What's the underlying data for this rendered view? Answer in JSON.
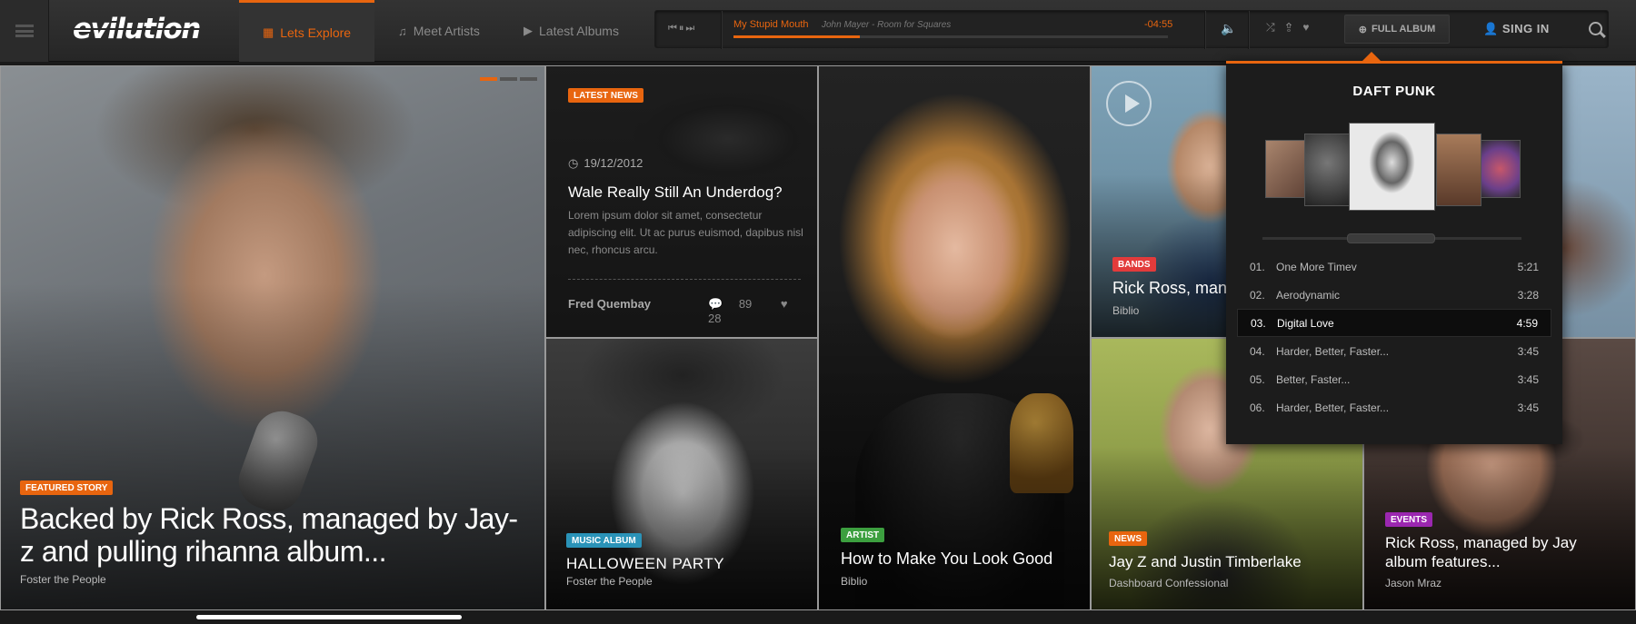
{
  "brand": {
    "logo": "evilution",
    "accent": "#e8650f"
  },
  "nav": {
    "items": [
      {
        "label": "Lets Explore",
        "icon": "grid-icon",
        "active": true
      },
      {
        "label": "Meet Artists",
        "icon": "music-note-icon"
      },
      {
        "label": "Latest Albums",
        "icon": "youtube-icon"
      }
    ],
    "signin": "SING IN"
  },
  "player": {
    "track": "My Stupid Mouth",
    "artist_album": "John Mayer - Room for Squares",
    "time": "-04:55",
    "progress": 0.29,
    "full_album_label": "FULL ALBUM"
  },
  "tiles": {
    "featured": {
      "badge": "FEATURED STORY",
      "title": "Backed by Rick Ross, managed by Jay-z and pulling rihanna album...",
      "sub": "Foster the People"
    },
    "latest_news": {
      "badge": "LATEST NEWS",
      "date": "19/12/2012",
      "title": "Wale Really Still An Underdog?",
      "text": "Lorem ipsum dolor sit amet, consectetur adipiscing elit. Ut ac purus euismod, dapibus nisl nec, rhoncus arcu.",
      "author": "Fred Quembay",
      "comments": "89",
      "likes": "28"
    },
    "music_album": {
      "badge": "MUSIC ALBUM",
      "title": "HALLOWEEN PARTY",
      "sub": "Foster the People"
    },
    "artist": {
      "badge": "ARTIST",
      "title": "How to Make You Look Good",
      "sub": "Biblio"
    },
    "bands": {
      "badge": "BANDS",
      "title": "Rick Ross, man",
      "sub": "Biblio"
    },
    "news": {
      "badge": "NEWS",
      "title": "Jay Z and Justin Timberlake",
      "sub": "Dashboard Confessional"
    },
    "events": {
      "badge": "EVENTS",
      "title": "Rick Ross, managed by Jay album features...",
      "sub": "Jason Mraz"
    }
  },
  "album_dropdown": {
    "artist": "DAFT PUNK",
    "tracks": [
      {
        "num": "01.",
        "title": "One More Timev",
        "duration": "5:21"
      },
      {
        "num": "02.",
        "title": "Aerodynamic",
        "duration": "3:28"
      },
      {
        "num": "03.",
        "title": "Digital Love",
        "duration": "4:59",
        "active": true
      },
      {
        "num": "04.",
        "title": "Harder, Better, Faster...",
        "duration": "3:45"
      },
      {
        "num": "05.",
        "title": "Better, Faster...",
        "duration": "3:45"
      },
      {
        "num": "06.",
        "title": "Harder, Better, Faster...",
        "duration": "3:45"
      }
    ]
  }
}
